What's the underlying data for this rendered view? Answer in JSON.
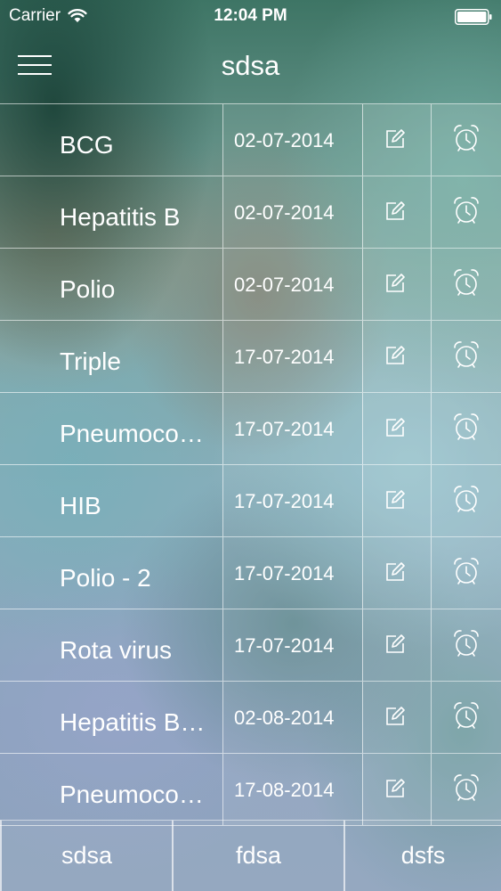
{
  "status_bar": {
    "carrier": "Carrier",
    "time": "12:04 PM"
  },
  "nav": {
    "title": "sdsa",
    "menu_icon": "hamburger-menu-icon"
  },
  "vaccines": [
    {
      "name": "BCG",
      "date": "02-07-2014"
    },
    {
      "name": "Hepatitis B",
      "date": "02-07-2014"
    },
    {
      "name": "Polio",
      "date": "02-07-2014"
    },
    {
      "name": "Triple",
      "date": "17-07-2014"
    },
    {
      "name": "Pneumoco…",
      "date": "17-07-2014"
    },
    {
      "name": "HIB",
      "date": "17-07-2014"
    },
    {
      "name": "Polio - 2",
      "date": "17-07-2014"
    },
    {
      "name": "Rota virus",
      "date": "17-07-2014"
    },
    {
      "name": "Hepatitis B…",
      "date": "02-08-2014"
    },
    {
      "name": "Pneumoco…",
      "date": "17-08-2014"
    }
  ],
  "row_icons": {
    "edit": "edit-icon",
    "alarm": "alarm-clock-icon"
  },
  "tabs": [
    {
      "label": "sdsa"
    },
    {
      "label": "fdsa"
    },
    {
      "label": "dsfs"
    }
  ]
}
